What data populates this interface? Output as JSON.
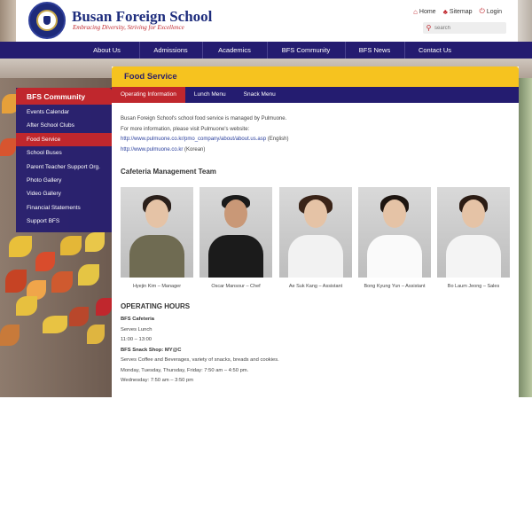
{
  "header": {
    "school_name": "Busan Foreign School",
    "tagline": "Embracing Diversity, Striving for Excellence",
    "top_links": [
      {
        "label": "Home",
        "icon": "home-icon"
      },
      {
        "label": "Sitemap",
        "icon": "sitemap-icon"
      },
      {
        "label": "Login",
        "icon": "power-icon"
      }
    ],
    "search_placeholder": "search"
  },
  "nav": {
    "items": [
      "About Us",
      "Admissions",
      "Academics",
      "BFS Community",
      "BFS News",
      "Contact Us"
    ]
  },
  "sidebar": {
    "title": "BFS Community",
    "items": [
      "Events Calendar",
      "After School Clubs",
      "Food Service",
      "School Buses",
      "Parent Teacher Support Org.",
      "Photo Gallery",
      "Video Gallery",
      "Financial Statements",
      "Support BFS"
    ],
    "active_index": 2
  },
  "page": {
    "title": "Food Service",
    "tabs": [
      "Operating Information",
      "Lunch Menu",
      "Snack Menu"
    ],
    "intro_line1": "Busan Foreign School's school food service is managed by Pulmuone.",
    "intro_line2": "For more information, please visit Pulmuone's website:",
    "link1_url": "http://www.pulmuone.co.kr/pmo_company/about/about.us.asp",
    "link1_suffix": " (English)",
    "link2_url": "http://www.pulmuone.co.kr",
    "link2_suffix": " (Korean)"
  },
  "team": {
    "heading": "Cafeteria Management Team",
    "members": [
      {
        "caption": "Hyejin Kim – Manager"
      },
      {
        "caption": "Oscar Mansour – Chef"
      },
      {
        "caption": "Ae Suk Kang – Assistant"
      },
      {
        "caption": "Bong Kyung Yun – Assistant"
      },
      {
        "caption": "Bo Laum Jeong – Sales"
      }
    ]
  },
  "hours": {
    "heading": "OPERATING HOURS",
    "cafeteria_title": "BFS Cafeteria",
    "cafeteria_line1": "Serves Lunch",
    "cafeteria_line2": "11:00 – 13:00",
    "snack_title": "BFS Snack Shop: MY@C",
    "snack_line1": "Serves Coffee and Beverages, variety of snacks, breads and cookies.",
    "snack_line2": "Monday, Tuesday, Thursday, Friday: 7:50 am – 4:50 pm.",
    "snack_line3": "Wednesday: 7:50 am – 3:50 pm"
  },
  "colors": {
    "navy": "#241c70",
    "red": "#c0272d",
    "gold": "#f6c31f"
  }
}
